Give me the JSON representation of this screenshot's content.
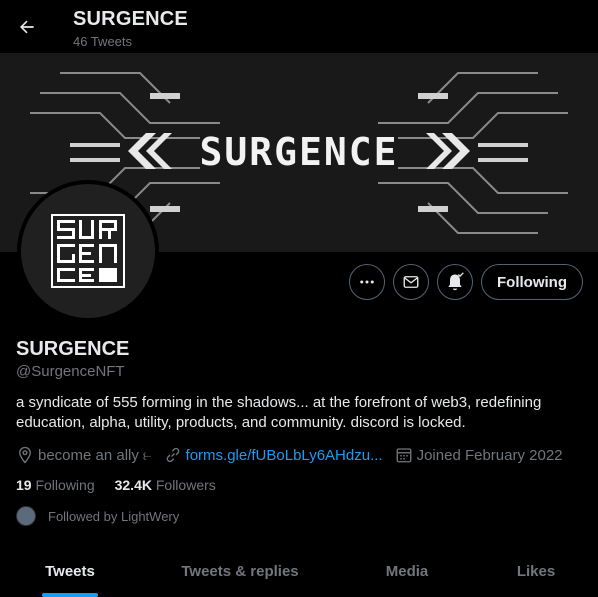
{
  "header": {
    "title": "SURGENCE",
    "subtitle": "46 Tweets"
  },
  "banner": {
    "wordmark": "SURGENCE"
  },
  "profile": {
    "name": "SURGENCE",
    "handle": "@SurgenceNFT",
    "bio": "a syndicate of 555 forming in the shadows... at the forefront of web3, redefining education, alpha, utility, products, and community. discord is locked.",
    "location": "become an ally ⥼",
    "website": "forms.gle/fUBoLbLy6AHdzu...",
    "joined": "Joined February 2022",
    "following_count": "19",
    "following_label": "Following",
    "followers_count": "32.4K",
    "followers_label": "Followers",
    "followed_by": "Followed by LightWery"
  },
  "actions": {
    "follow_state": "Following"
  },
  "tabs": [
    {
      "label": "Tweets",
      "active": true
    },
    {
      "label": "Tweets & replies",
      "active": false
    },
    {
      "label": "Media",
      "active": false
    },
    {
      "label": "Likes",
      "active": false
    }
  ],
  "colors": {
    "accent": "#1d9bf0",
    "muted": "#71767b",
    "text": "#e7e9ea",
    "background": "#000000"
  }
}
